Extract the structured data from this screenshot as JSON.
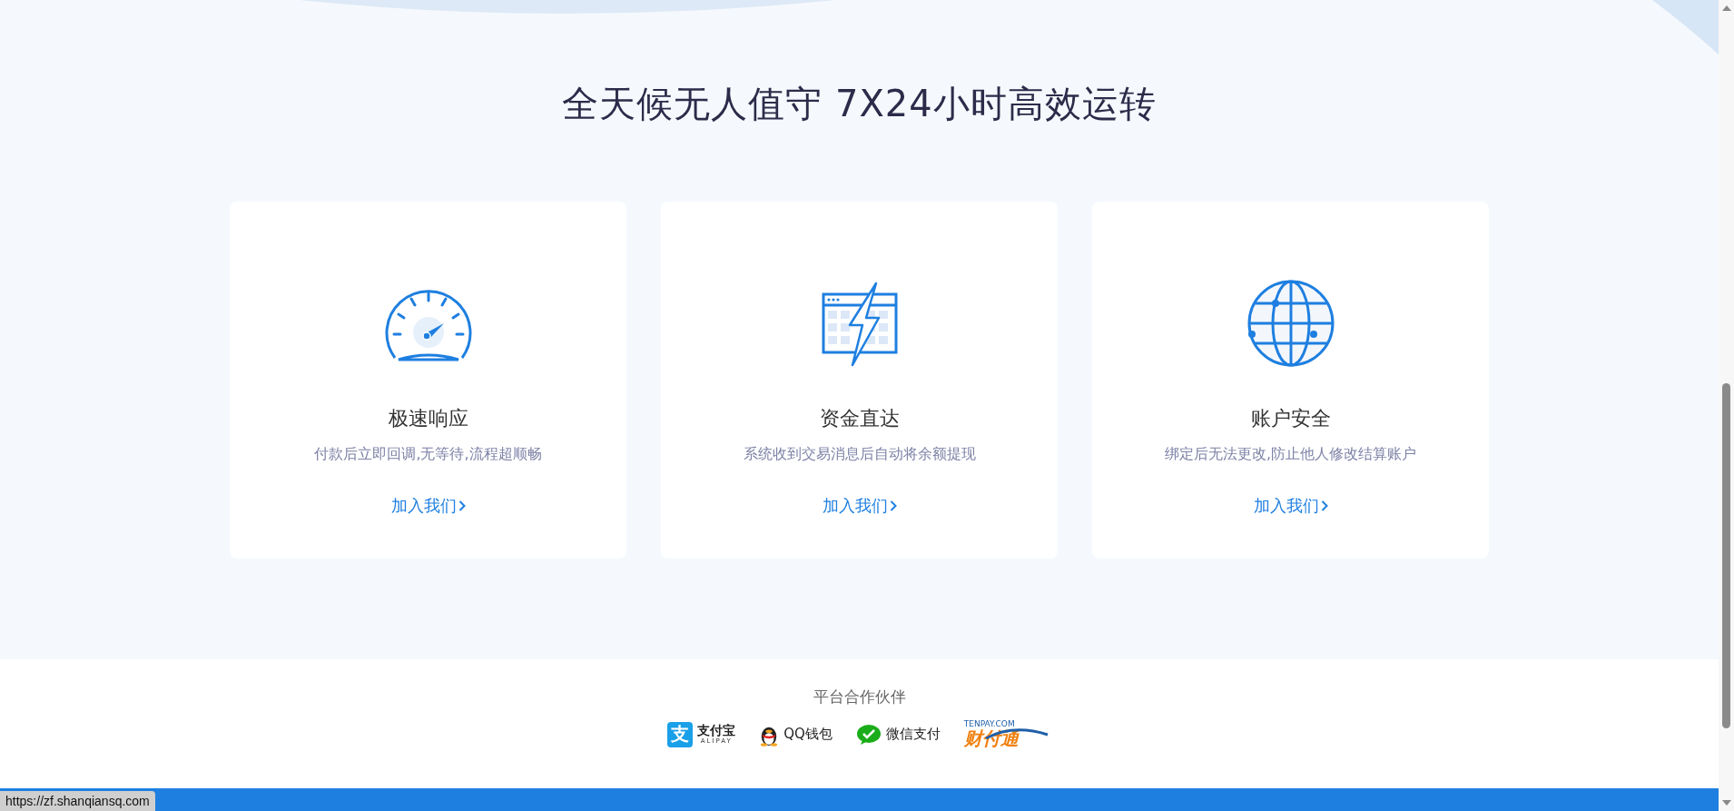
{
  "title": "全天候无人值守 7X24小时高效运转",
  "features": [
    {
      "kind": "speed",
      "title": "极速响应",
      "description": "付款后立即回调,无等待,流程超顺畅",
      "link": "加入我们"
    },
    {
      "kind": "funds",
      "title": "资金直达",
      "description": "系统收到交易消息后自动将余额提现",
      "link": "加入我们"
    },
    {
      "kind": "security",
      "title": "账户安全",
      "description": "绑定后无法更改,防止他人修改结算账户",
      "link": "加入我们"
    }
  ],
  "partners": {
    "title": "平台合作伙伴",
    "items": [
      {
        "kind": "alipay",
        "mark": "支",
        "name": "支付宝",
        "subtitle": "ALIPAY"
      },
      {
        "kind": "qq",
        "name": "QQ钱包"
      },
      {
        "kind": "wechat",
        "name": "微信支付"
      },
      {
        "kind": "tenpay",
        "name": "财付通",
        "subtitle": "TENPAY.COM"
      }
    ]
  },
  "status_url": "https://zf.shanqiansq.com"
}
